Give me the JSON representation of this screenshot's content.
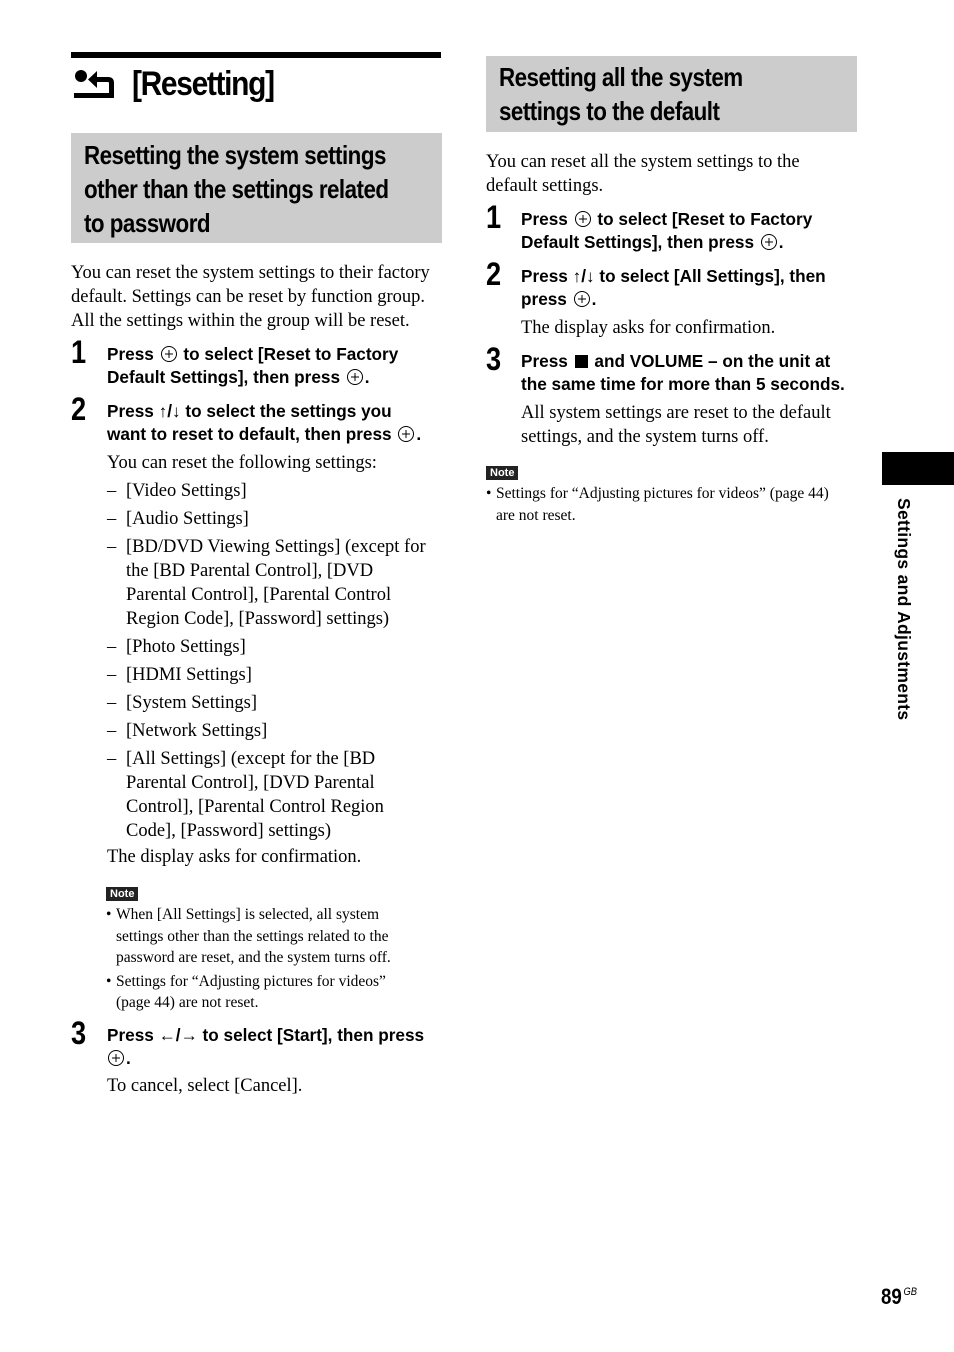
{
  "page_title": "[Resetting]",
  "left": {
    "heading": [
      "Resetting the system settings",
      "other than the settings related",
      "to password"
    ],
    "intro": [
      "You can reset the system settings to their factory",
      "default. Settings can be reset by function group.",
      "All the settings within the group will be reset."
    ],
    "steps": [
      {
        "number": "1",
        "lines": [
          [
            "Press ",
            "{enter}",
            " to select [Reset to Factory"
          ],
          [
            "Default Settings], then press ",
            "{enter}",
            "."
          ]
        ]
      },
      {
        "number": "2",
        "lines": [
          [
            "Press ↑/↓ to select the settings you"
          ],
          [
            "want to reset to default, then press ",
            "{enter}",
            "."
          ]
        ],
        "after": "You can reset the following settings:"
      },
      {
        "number": "3",
        "lines": [
          [
            "Press ←/→ to select [Start], then press"
          ],
          [
            "{enter}",
            "."
          ]
        ],
        "after": "To cancel, select [Cancel]."
      }
    ],
    "settings_list": [
      [
        "[Video Settings]"
      ],
      [
        "[Audio Settings]"
      ],
      [
        "[BD/DVD Viewing Settings] (except for",
        "the [BD Parental Control], [DVD",
        "Parental Control], [Parental Control",
        "Region Code], [Password] settings)"
      ],
      [
        "[Photo Settings]"
      ],
      [
        "[HDMI Settings]"
      ],
      [
        "[System Settings]"
      ],
      [
        "[Network Settings]"
      ],
      [
        "[All Settings] (except for the [BD",
        "Parental Control], [DVD Parental",
        "Control], [Parental Control Region",
        "Code], [Password] settings)"
      ]
    ],
    "list_dash": "–",
    "confirmation": "The display asks for confirmation.",
    "note_label": "Note",
    "notes": [
      [
        "When [All Settings] is selected, all system",
        "settings other than the settings related to the",
        "password are reset, and the system turns off."
      ],
      [
        "Settings for “Adjusting pictures for videos”",
        "(page 44) are not reset."
      ]
    ]
  },
  "right": {
    "heading": [
      "Resetting all the system",
      "settings to the default"
    ],
    "intro": [
      "You can reset all the system settings to the",
      "default settings."
    ],
    "steps": [
      {
        "number": "1",
        "lines": [
          [
            "Press ",
            "{enter}",
            " to select [Reset to Factory"
          ],
          [
            "Default Settings], then press ",
            "{enter}",
            "."
          ]
        ]
      },
      {
        "number": "2",
        "lines": [
          [
            "Press ↑/↓ to select [All Settings], then"
          ],
          [
            "press ",
            "{enter}",
            "."
          ]
        ],
        "after": [
          "The display asks for confirmation."
        ]
      },
      {
        "number": "3",
        "lines": [
          [
            "Press ",
            "{stop}",
            " and VOLUME – on the unit at"
          ],
          [
            "the same time for more than 5 seconds."
          ]
        ],
        "after": [
          "All system settings are reset to the default",
          "settings, and the system turns off."
        ]
      }
    ],
    "note_label": "Note",
    "notes": [
      [
        "Settings for “Adjusting pictures for videos” (page 44)",
        "are not reset."
      ]
    ]
  },
  "side_tab_label": "Settings and Adjustments",
  "page_number": "89",
  "page_suffix": "GB",
  "bullet": "•"
}
